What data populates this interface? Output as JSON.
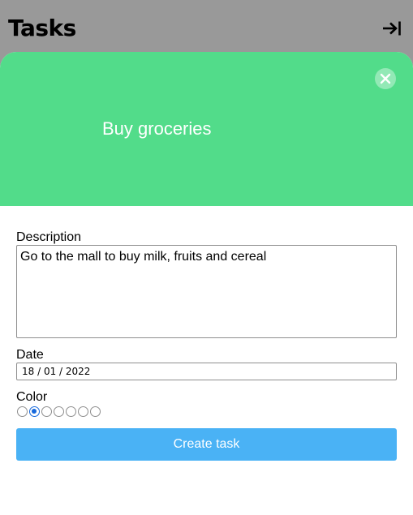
{
  "app": {
    "title": "Tasks"
  },
  "icons": {
    "logout": "arrow-right-to-bar-icon",
    "close": "close-icon"
  },
  "task": {
    "title": "Buy groceries",
    "banner_color": "#52dc8a"
  },
  "form": {
    "description_label": "Description",
    "description_value": "Go to the mall to buy milk, fruits and cereal",
    "date_label": "Date",
    "date_value": "18 / 01 / 2022",
    "color_label": "Color",
    "color_options_count": 7,
    "color_selected_index": 1,
    "submit_label": "Create task",
    "submit_color": "#4ab2f5"
  }
}
